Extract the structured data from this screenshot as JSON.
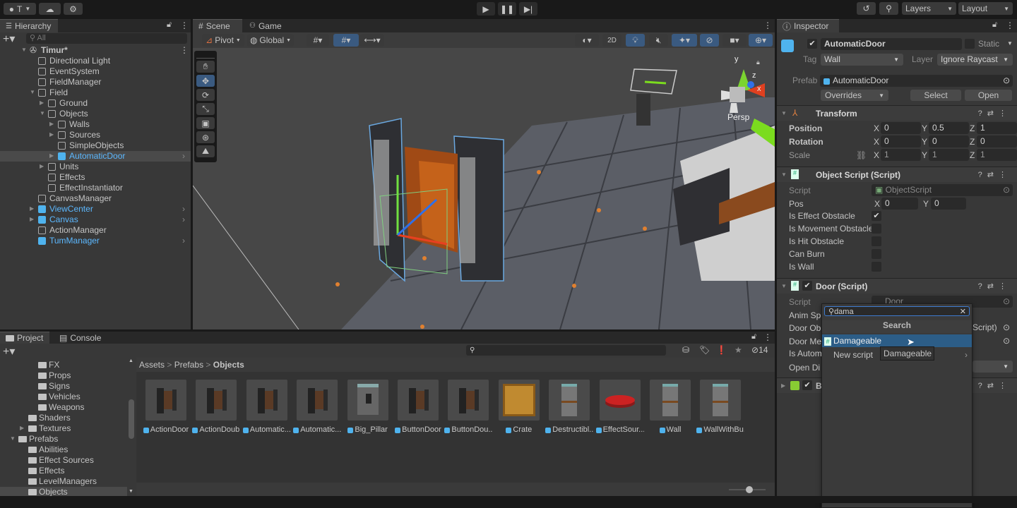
{
  "topbar": {
    "account_label": "T",
    "layers_label": "Layers",
    "layout_label": "Layout"
  },
  "hierarchy": {
    "tab_label": "Hierarchy",
    "search_placeholder": "All",
    "items": [
      {
        "label": "Timur*",
        "depth": 0,
        "expanded": true,
        "type": "scene"
      },
      {
        "label": "Directional Light",
        "depth": 1,
        "type": "object"
      },
      {
        "label": "EventSystem",
        "depth": 1,
        "type": "object"
      },
      {
        "label": "FieldManager",
        "depth": 1,
        "type": "object"
      },
      {
        "label": "Field",
        "depth": 1,
        "expanded": true,
        "type": "object"
      },
      {
        "label": "Ground",
        "depth": 2,
        "collapsed": true,
        "type": "object"
      },
      {
        "label": "Objects",
        "depth": 2,
        "expanded": true,
        "type": "object"
      },
      {
        "label": "Walls",
        "depth": 3,
        "collapsed": true,
        "type": "object"
      },
      {
        "label": "Sources",
        "depth": 3,
        "collapsed": true,
        "type": "object"
      },
      {
        "label": "SimpleObjects",
        "depth": 3,
        "type": "object"
      },
      {
        "label": "AutomaticDoor",
        "depth": 3,
        "collapsed": true,
        "type": "prefab",
        "selected": true
      },
      {
        "label": "Units",
        "depth": 2,
        "collapsed": true,
        "type": "object"
      },
      {
        "label": "Effects",
        "depth": 2,
        "type": "object"
      },
      {
        "label": "EffectInstantiator",
        "depth": 2,
        "type": "object"
      },
      {
        "label": "CanvasManager",
        "depth": 1,
        "type": "object"
      },
      {
        "label": "ViewCenter",
        "depth": 1,
        "collapsed": true,
        "type": "prefab"
      },
      {
        "label": "Canvas",
        "depth": 1,
        "collapsed": true,
        "type": "prefab"
      },
      {
        "label": "ActionManager",
        "depth": 1,
        "type": "object"
      },
      {
        "label": "TumManager",
        "depth": 1,
        "type": "prefab"
      }
    ]
  },
  "scene": {
    "tabs": [
      "Scene",
      "Game"
    ],
    "pivot_label": "Pivot",
    "global_label": "Global",
    "mode_2d_label": "2D",
    "gizmo": {
      "y": "y",
      "z": "z",
      "x": "x",
      "projection": "Persp"
    }
  },
  "inspector": {
    "tab_label": "Inspector",
    "object_name": "AutomaticDoor",
    "active": true,
    "static_label": "Static",
    "tag_label": "Tag",
    "tag_value": "Wall",
    "layer_label": "Layer",
    "layer_value": "Ignore Raycast",
    "prefab_label": "Prefab",
    "prefab_value": "AutomaticDoor",
    "overrides_label": "Overrides",
    "select_label": "Select",
    "open_label": "Open",
    "transform": {
      "title": "Transform",
      "rows": [
        {
          "label": "Position",
          "x": "0",
          "y": "0.5",
          "z": "1"
        },
        {
          "label": "Rotation",
          "x": "0",
          "y": "0",
          "z": "0"
        },
        {
          "label": "Scale",
          "x": "1",
          "y": "1",
          "z": "1"
        }
      ]
    },
    "object_script": {
      "title": "Object Script (Script)",
      "script_label": "Script",
      "script_value": "ObjectScript",
      "pos_label": "Pos",
      "pos_x": "0",
      "pos_y": "0",
      "toggles": [
        {
          "label": "Is Effect Obstacle",
          "checked": true
        },
        {
          "label": "Is Movement Obstacle",
          "checked": false
        },
        {
          "label": "Is Hit Obstacle",
          "checked": false
        },
        {
          "label": "Can Burn",
          "checked": false
        },
        {
          "label": "Is Wall",
          "checked": false
        }
      ]
    },
    "door_script": {
      "title": "Door (Script)",
      "script_label": "Script",
      "script_value": "Door",
      "fields": [
        "Anim Sp",
        "Door Ob",
        "Door Me",
        "Is Autom",
        "Open Di"
      ],
      "door_ob_value": "Script)"
    },
    "next_component_initial": "B",
    "add_component_popup": {
      "search_value": "dama",
      "header": "Search",
      "results": [
        "Damageable"
      ],
      "new_script_label": "New script",
      "tooltip": "Damageable"
    }
  },
  "project": {
    "tabs": [
      "Project",
      "Console"
    ],
    "hidden_count": "14",
    "folders": [
      {
        "label": "FX",
        "depth": 2
      },
      {
        "label": "Props",
        "depth": 2
      },
      {
        "label": "Signs",
        "depth": 2
      },
      {
        "label": "Vehicles",
        "depth": 2
      },
      {
        "label": "Weapons",
        "depth": 2
      },
      {
        "label": "Shaders",
        "depth": 1
      },
      {
        "label": "Textures",
        "depth": 1,
        "collapsed": true
      },
      {
        "label": "Prefabs",
        "depth": 0,
        "expanded": true
      },
      {
        "label": "Abilities",
        "depth": 1
      },
      {
        "label": "Effect Sources",
        "depth": 1
      },
      {
        "label": "Effects",
        "depth": 1
      },
      {
        "label": "LevelManagers",
        "depth": 1
      },
      {
        "label": "Objects",
        "depth": 1,
        "selected": true
      }
    ],
    "breadcrumb": [
      "Assets",
      "Prefabs",
      "Objects"
    ],
    "assets": [
      {
        "label": "ActionDoor",
        "thumb": "door"
      },
      {
        "label": "ActionDoub...",
        "thumb": "door"
      },
      {
        "label": "Automatic...",
        "thumb": "door"
      },
      {
        "label": "Automatic...",
        "thumb": "door"
      },
      {
        "label": "Big_Pillar",
        "thumb": "pillar"
      },
      {
        "label": "ButtonDoor",
        "thumb": "door"
      },
      {
        "label": "ButtonDou...",
        "thumb": "door"
      },
      {
        "label": "Crate",
        "thumb": "crate"
      },
      {
        "label": "Destructibl...",
        "thumb": "wall"
      },
      {
        "label": "EffectSour...",
        "thumb": "disc"
      },
      {
        "label": "Wall",
        "thumb": "wall"
      },
      {
        "label": "WallWithBu...",
        "thumb": "wall"
      }
    ]
  },
  "colors": {
    "accent": "#3a5a80",
    "selection": "#2c5d87",
    "prefab_blue": "#4fb3ee",
    "panel": "#383838"
  }
}
